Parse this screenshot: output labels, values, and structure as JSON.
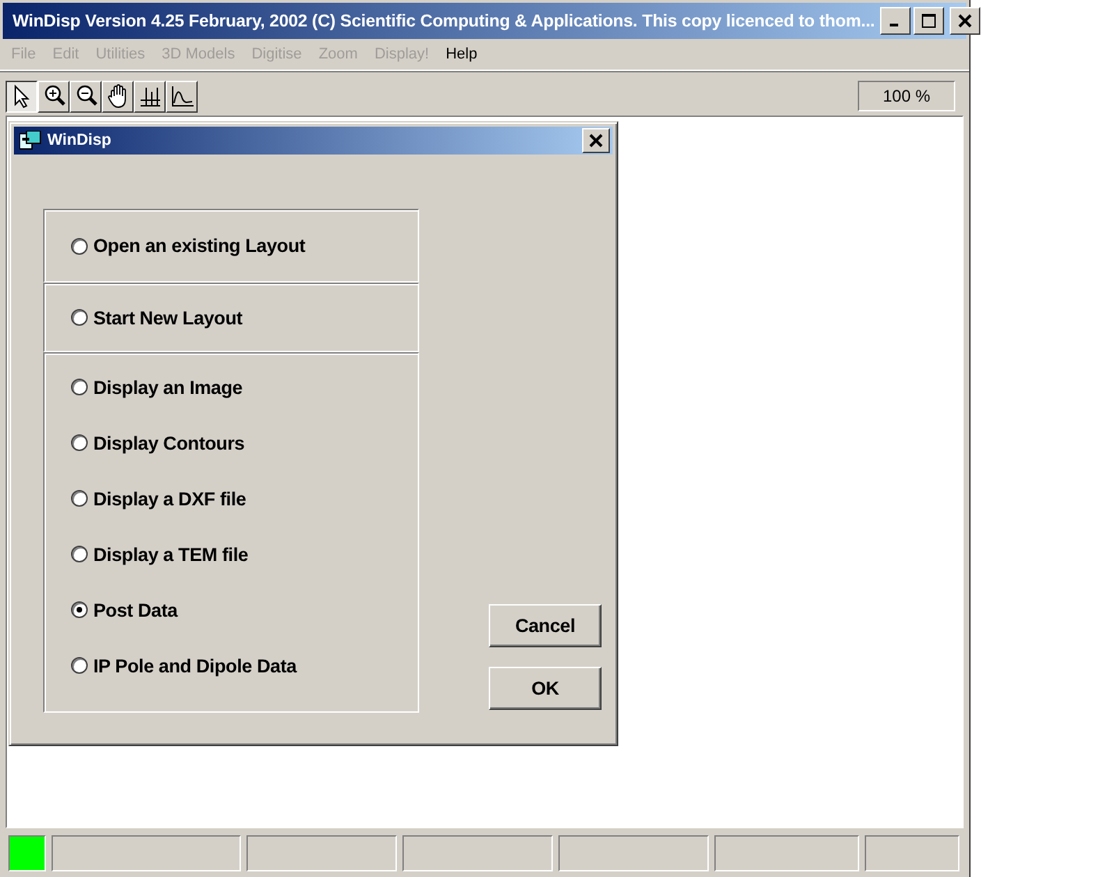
{
  "window": {
    "title": "WinDisp Version 4.25 February, 2002 (C) Scientific Computing & Applications. This copy licenced to thom..."
  },
  "menu": [
    {
      "label": "File",
      "disabled": true
    },
    {
      "label": "Edit",
      "disabled": true
    },
    {
      "label": "Utilities",
      "disabled": true
    },
    {
      "label": "3D Models",
      "disabled": true
    },
    {
      "label": "Digitise",
      "disabled": true
    },
    {
      "label": "Zoom",
      "disabled": true
    },
    {
      "label": "Display!",
      "disabled": true
    },
    {
      "label": "Help",
      "disabled": false
    }
  ],
  "toolbar": {
    "tools": [
      {
        "kind": "pointer",
        "selected": true
      },
      {
        "kind": "zoom-in",
        "selected": false
      },
      {
        "kind": "zoom-out",
        "selected": false
      },
      {
        "kind": "hand",
        "selected": false
      },
      {
        "kind": "grid",
        "selected": false
      },
      {
        "kind": "graph",
        "selected": false
      }
    ],
    "zoom": "100 %"
  },
  "dialog": {
    "title": "WinDisp",
    "groups": [
      [
        {
          "label": "Open an existing Layout",
          "selected": false
        }
      ],
      [
        {
          "label": "Start New Layout",
          "selected": false
        }
      ],
      [
        {
          "label": "Display an Image",
          "selected": false
        },
        {
          "label": "Display Contours",
          "selected": false
        },
        {
          "label": "Display a DXF file",
          "selected": false
        },
        {
          "label": "Display a TEM file",
          "selected": false
        },
        {
          "label": "Post Data",
          "selected": true
        },
        {
          "label": "IP Pole and Dipole Data",
          "selected": false
        }
      ]
    ],
    "buttons": [
      "Cancel",
      "OK"
    ]
  },
  "status_bar": {
    "indicator": {
      "color": "#00ff00"
    }
  }
}
